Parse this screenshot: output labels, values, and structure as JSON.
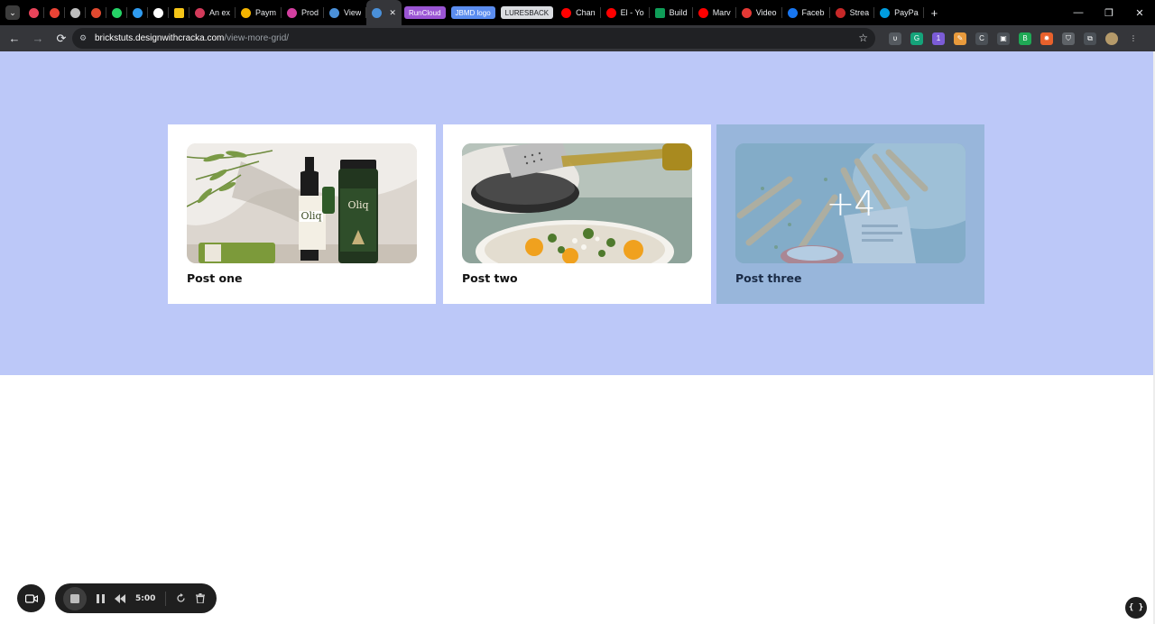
{
  "browser": {
    "tabs": [
      {
        "label": "",
        "icon": "target-icon",
        "color": "#e8445a"
      },
      {
        "label": "",
        "icon": "gmail-icon",
        "color": "#ea4335"
      },
      {
        "label": "",
        "icon": "openai-icon",
        "color": "#bdbdbd"
      },
      {
        "label": "",
        "icon": "asterisk-icon",
        "color": "#e0492f"
      },
      {
        "label": "",
        "icon": "whatsapp-icon",
        "color": "#25d366"
      },
      {
        "label": "",
        "icon": "vscode-icon",
        "color": "#2f9bf0"
      },
      {
        "label": "",
        "icon": "github-icon",
        "color": "#ffffff"
      },
      {
        "label": "",
        "icon": "bookmark-icon",
        "color": "#f5c518"
      },
      {
        "label": "An ex",
        "icon": "h-icon",
        "color": "#d23a5a"
      },
      {
        "label": "Paym",
        "icon": "drive-icon",
        "color": "#f4b400"
      },
      {
        "label": "Prod",
        "icon": "circle-icon",
        "color": "#d33fa0"
      },
      {
        "label": "View",
        "icon": "wordpress-icon",
        "color": "#4a90d9"
      },
      {
        "label": "",
        "icon": "wordpress-icon",
        "color": "#4a90d9",
        "active": true,
        "close": "✕"
      },
      {
        "label": "RunCloud",
        "pill": true,
        "bg": "#9b55d4",
        "fg": "#ffffff"
      },
      {
        "label": "JBMD logo",
        "pill": true,
        "bg": "#5b8def",
        "fg": "#ffffff"
      },
      {
        "label": "LURESBACK",
        "pill": true,
        "bg": "#dadce0",
        "fg": "#202124"
      },
      {
        "label": "Chan",
        "icon": "youtube-icon",
        "color": "#ff0000"
      },
      {
        "label": "El - Yo",
        "icon": "youtube-icon",
        "color": "#ff0000"
      },
      {
        "label": "Build",
        "icon": "sheets-icon",
        "color": "#0f9d58"
      },
      {
        "label": "Marv",
        "icon": "youtube-icon",
        "color": "#ff0000"
      },
      {
        "label": "Video",
        "icon": "video-icon",
        "color": "#e53935"
      },
      {
        "label": "Faceb",
        "icon": "facebook-icon",
        "color": "#1877f2"
      },
      {
        "label": "Strea",
        "icon": "stream-icon",
        "color": "#c62828"
      },
      {
        "label": "PayPa",
        "icon": "paypal-icon",
        "color": "#009cde"
      }
    ],
    "new_tab": "+",
    "window_controls": {
      "minimize": "—",
      "restore": "❐",
      "close": "✕"
    },
    "url_host": "brickstuts.designwithcracka.com",
    "url_path": "/view-more-grid/",
    "star": "☆",
    "nav": {
      "back": "←",
      "forward": "→",
      "reload": "⟳"
    },
    "extensions": [
      {
        "icon": "extension-1-icon",
        "color": "#555a60",
        "glyph": "υ"
      },
      {
        "icon": "grammarly-icon",
        "color": "#15a37a",
        "glyph": "G"
      },
      {
        "icon": "puzzle-badge-icon",
        "color": "#7b5cd6",
        "glyph": "1"
      },
      {
        "icon": "pencil-icon",
        "color": "#e89a3c",
        "glyph": "✎"
      },
      {
        "icon": "refresh-ext-icon",
        "color": "#4b5056",
        "glyph": "C"
      },
      {
        "icon": "screenshot-icon",
        "color": "#4b5056",
        "glyph": "▣"
      },
      {
        "icon": "green-ext-icon",
        "color": "#1fa855",
        "glyph": "B"
      },
      {
        "icon": "orange-ext-icon",
        "color": "#e8612c",
        "glyph": "✹"
      },
      {
        "icon": "shield-icon",
        "color": "#5f6368",
        "glyph": "⛉"
      },
      {
        "icon": "extensions-puzzle-icon",
        "color": "#4b5056",
        "glyph": "⧉"
      },
      {
        "icon": "profile-avatar-icon",
        "color": "#b59a6a",
        "glyph": ""
      },
      {
        "icon": "menu-kebab-icon",
        "color": "#35363a",
        "glyph": "⋮"
      }
    ]
  },
  "page": {
    "hero_color": "#bcc8f8",
    "cards": [
      {
        "title": "Post one",
        "image": "olive-oil-bottles-image"
      },
      {
        "title": "Post two",
        "image": "salad-bowl-image"
      },
      {
        "title": "Post three",
        "image": "grilled-skewers-image",
        "more_count": "+4"
      }
    ]
  },
  "recorder": {
    "time": "5:00",
    "camera": "camera-icon",
    "stop": "stop-icon",
    "pause": "pause-icon",
    "rewind": "rewind-icon",
    "restart": "restart-icon",
    "delete": "trash-icon",
    "code_badge": "{ }"
  }
}
